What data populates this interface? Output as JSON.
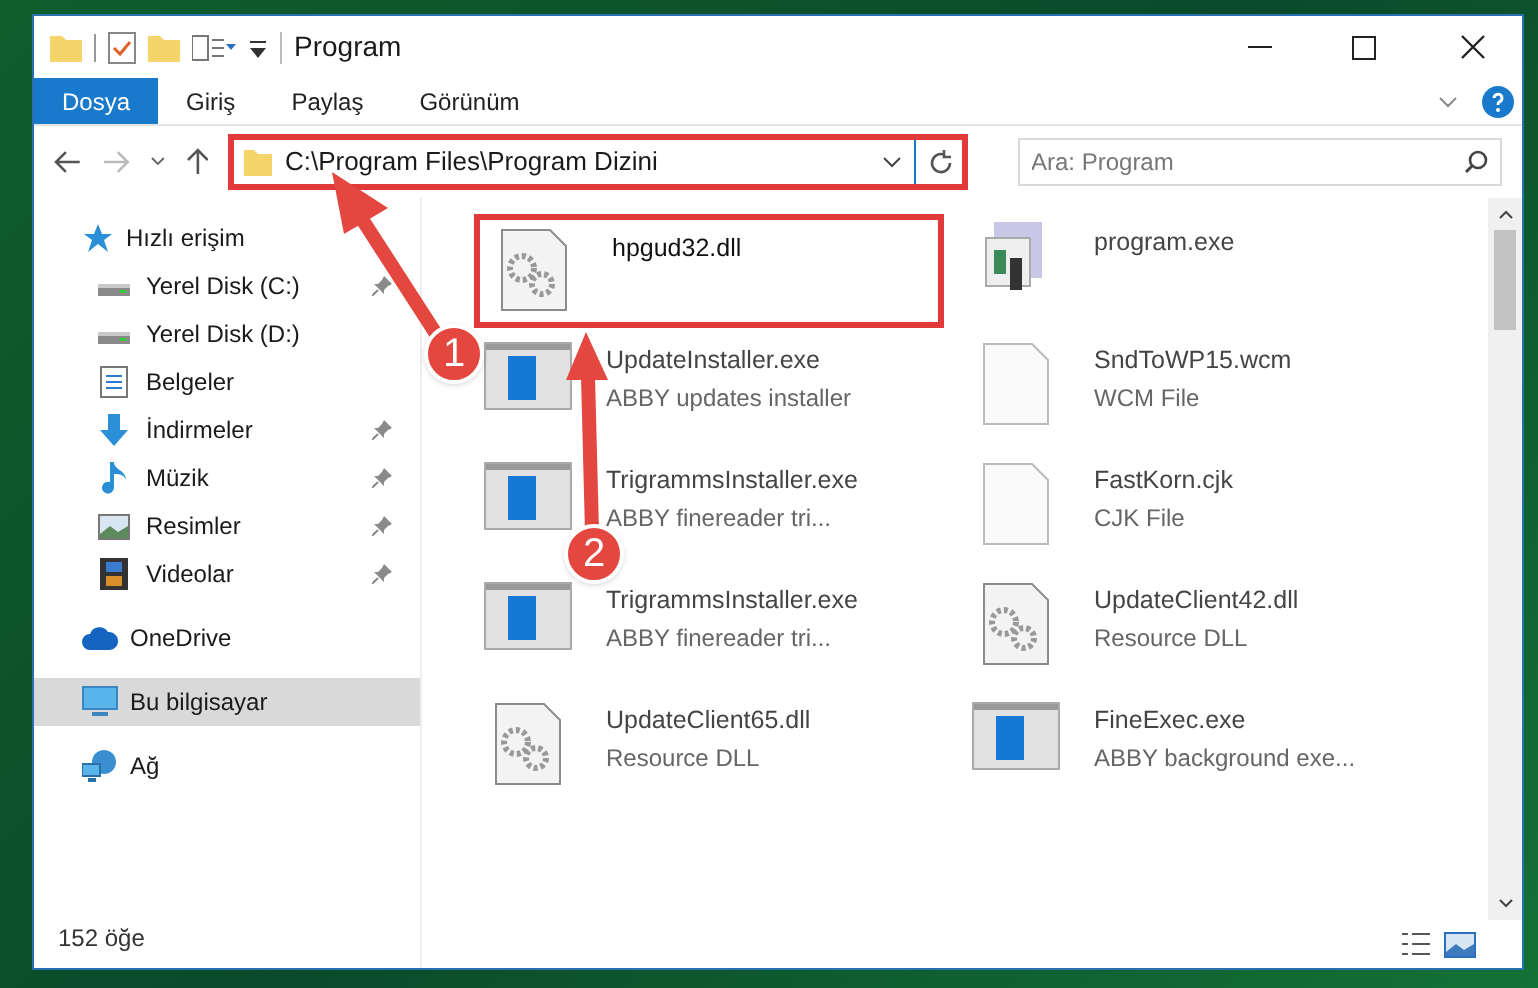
{
  "window": {
    "title": "Program"
  },
  "ribbon_tabs": [
    {
      "label": "Dosya",
      "selected": true
    },
    {
      "label": "Giriş",
      "selected": false
    },
    {
      "label": "Paylaş",
      "selected": false
    },
    {
      "label": "Görünüm",
      "selected": false
    }
  ],
  "address": {
    "path": "C:\\Program Files\\Program Dizini",
    "highlighted": true
  },
  "search": {
    "placeholder": "Ara: Program"
  },
  "nav": [
    {
      "label": "Hızlı erişim",
      "kind": "star",
      "selected": false,
      "children": [
        {
          "label": "Yerel Disk (C:)",
          "kind": "drive",
          "pinned": true
        },
        {
          "label": "Yerel Disk (D:)",
          "kind": "drive",
          "pinned": false
        },
        {
          "label": "Belgeler",
          "kind": "doc",
          "pinned": false
        },
        {
          "label": "İndirmeler",
          "kind": "download",
          "pinned": true
        },
        {
          "label": "Müzik",
          "kind": "music",
          "pinned": true
        },
        {
          "label": "Resimler",
          "kind": "image",
          "pinned": true
        },
        {
          "label": "Videolar",
          "kind": "video",
          "pinned": true
        }
      ]
    },
    {
      "label": "OneDrive",
      "kind": "cloud",
      "selected": false
    },
    {
      "label": "Bu bilgisayar",
      "kind": "pc",
      "selected": true
    },
    {
      "label": "Ağ",
      "kind": "network",
      "selected": false
    }
  ],
  "files": [
    {
      "name": "hpgud32.dll",
      "kind": "dll",
      "highlighted": true
    },
    {
      "name": "program.exe",
      "kind": "program",
      "highlighted": false
    },
    {
      "name": "UpdateInstaller.exe",
      "detail": "ABBY updates installer",
      "kind": "app",
      "highlighted": false
    },
    {
      "name": "SndToWP15.wcm",
      "detail": "WCM File",
      "kind": "page",
      "highlighted": false
    },
    {
      "name": "TrigrammsInstaller.exe",
      "detail": "ABBY finereader tri...",
      "kind": "app",
      "highlighted": false
    },
    {
      "name": "FastKorn.cjk",
      "detail": "CJK File",
      "kind": "page",
      "highlighted": false
    },
    {
      "name": "TrigrammsInstaller.exe",
      "detail": "ABBY finereader tri...",
      "kind": "app",
      "highlighted": false
    },
    {
      "name": "UpdateClient42.dll",
      "detail": "Resource DLL",
      "kind": "dll",
      "highlighted": false
    },
    {
      "name": "UpdateClient65.dll",
      "detail": "Resource DLL",
      "kind": "dll",
      "highlighted": false
    },
    {
      "name": "FineExec.exe",
      "detail": "ABBY background exe...",
      "kind": "app",
      "highlighted": false
    }
  ],
  "status_bar": {
    "count": "152 öğe"
  },
  "annotations": [
    {
      "label": "1"
    },
    {
      "label": "2"
    }
  ]
}
